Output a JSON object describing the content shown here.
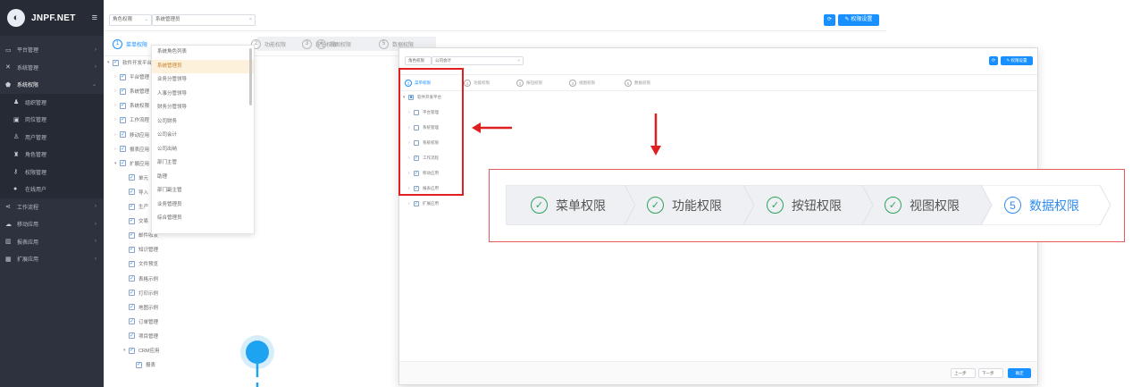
{
  "brand": {
    "name": "JNPF.NET",
    "logo_icon": "jnpf-logo-icon",
    "menu_icon": "hamburger-icon"
  },
  "sidebar": {
    "items": [
      {
        "icon": "desktop-icon",
        "label": "平台管理",
        "active": false,
        "sub": false
      },
      {
        "icon": "cross-icon",
        "label": "系统管理",
        "active": false,
        "sub": false
      },
      {
        "icon": "shield-icon",
        "label": "系统权限",
        "active": true,
        "sub": false
      },
      {
        "icon": "user-icon",
        "label": "组织管理",
        "active": false,
        "sub": true
      },
      {
        "icon": "building-icon",
        "label": "岗位管理",
        "active": false,
        "sub": true
      },
      {
        "icon": "person-icon",
        "label": "用户管理",
        "active": false,
        "sub": true
      },
      {
        "icon": "role-icon",
        "label": "角色管理",
        "active": false,
        "sub": true
      },
      {
        "icon": "key-icon",
        "label": "权限管理",
        "active": false,
        "sub": true
      },
      {
        "icon": "online-icon",
        "label": "在线用户",
        "active": false,
        "sub": true
      },
      {
        "icon": "share-icon",
        "label": "工作流程",
        "active": false,
        "sub": false
      },
      {
        "icon": "chat-icon",
        "label": "移动应用",
        "active": false,
        "sub": false
      },
      {
        "icon": "chart-icon",
        "label": "报表应用",
        "active": false,
        "sub": false
      },
      {
        "icon": "grid-icon",
        "label": "扩展应用",
        "active": false,
        "sub": false
      }
    ]
  },
  "back_window": {
    "toolbar": {
      "select1": "角色权限",
      "select2": "系统管理员",
      "settings_label": "权限设置"
    },
    "steps": [
      "菜单权限",
      "功能权限",
      "按钮权限",
      "视图权限",
      "数据权限"
    ],
    "tree": [
      "软件开发平台",
      "平台管理",
      "系统管理",
      "系统权限",
      "工作流程",
      "移动应用",
      "报表应用",
      "扩展应用",
      "单元",
      "导入",
      "生产",
      "交易",
      "邮件收发",
      "知识管理",
      "文件预览",
      "表格示例",
      "打印示例",
      "地图示例",
      "订单管理",
      "项目管理",
      "CRM应用",
      "报表"
    ],
    "dropdown": [
      "系统角色列表",
      "系统管理员",
      "业务分管领导",
      "人事分管领导",
      "财务分管领导",
      "公司财务",
      "公司会计",
      "公司出纳",
      "部门主管",
      "助理",
      "部门副主管",
      "业务管理员",
      "综合管理员"
    ],
    "dropdown_highlight": 1
  },
  "front_window": {
    "select1": "角色权限",
    "select2": "公司会计",
    "settings_label": "权限设置",
    "steps": [
      "菜单权限",
      "功能权限",
      "按钮权限",
      "视图权限",
      "数据权限"
    ],
    "tree": [
      "软件开发平台",
      "平台管理",
      "系统管理",
      "系统权限",
      "工作流程",
      "移动应用",
      "报表应用",
      "扩展应用"
    ],
    "tree_checked": [
      false,
      false,
      false,
      false,
      true,
      true,
      true,
      true
    ],
    "footer": {
      "prev": "上一步",
      "next": "下一步",
      "finish": "确定"
    }
  },
  "zoom": {
    "steps": [
      {
        "label": "菜单权限",
        "done": true
      },
      {
        "label": "功能权限",
        "done": true
      },
      {
        "label": "按钮权限",
        "done": true
      },
      {
        "label": "视图权限",
        "done": true
      },
      {
        "label": "数据权限",
        "done": false,
        "num": "5"
      }
    ]
  },
  "colors": {
    "sidebar_bg": "#2d323e",
    "accent": "#1890ff",
    "highlight_red": "#e02020",
    "done_green": "#2ea35b",
    "pin_blue": "#1ea3f0"
  }
}
